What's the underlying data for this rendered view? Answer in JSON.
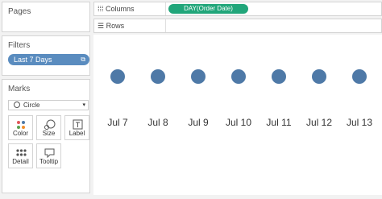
{
  "pages": {
    "title": "Pages"
  },
  "filters": {
    "title": "Filters",
    "pill": {
      "label": "Last 7 Days",
      "icon": "filter-applied-icon"
    }
  },
  "marks": {
    "title": "Marks",
    "mark_type": "Circle",
    "buttons": [
      {
        "label": "Color",
        "icon": "color-icon"
      },
      {
        "label": "Size",
        "icon": "size-icon"
      },
      {
        "label": "Label",
        "icon": "label-icon"
      },
      {
        "label": "Detail",
        "icon": "detail-icon"
      },
      {
        "label": "Tooltip",
        "icon": "tooltip-icon"
      }
    ]
  },
  "shelves": {
    "columns": {
      "label": "Columns",
      "icon": "columns-icon",
      "pill": "DAY(Order Date)"
    },
    "rows": {
      "label": "Rows",
      "icon": "rows-icon"
    }
  },
  "chart_data": {
    "type": "scatter",
    "categories": [
      "Jul 7",
      "Jul 8",
      "Jul 9",
      "Jul 10",
      "Jul 11",
      "Jul 12",
      "Jul 13"
    ],
    "mark": "circle",
    "color": "#4e79a7"
  }
}
